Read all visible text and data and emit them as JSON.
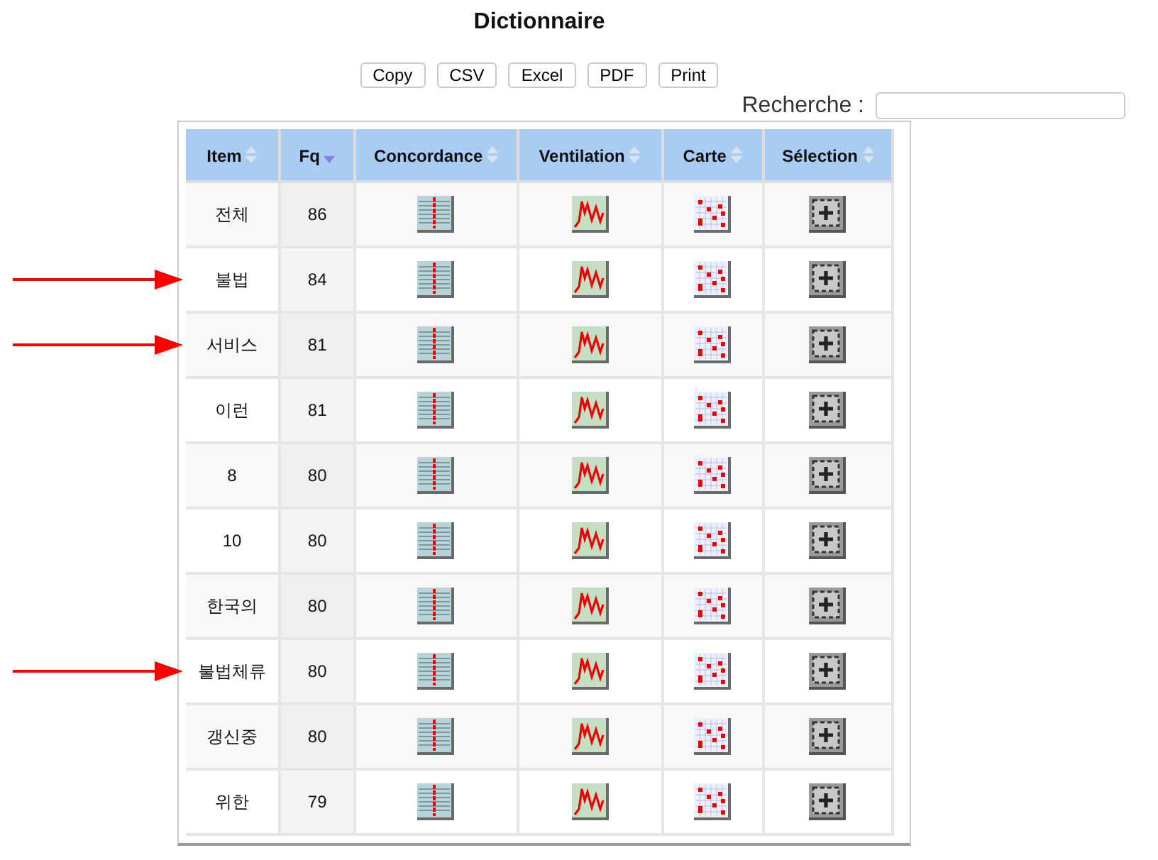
{
  "title": "Dictionnaire",
  "buttons": [
    "Copy",
    "CSV",
    "Excel",
    "PDF",
    "Print"
  ],
  "search": {
    "label": "Recherche :"
  },
  "table": {
    "columns": [
      {
        "label": "Item",
        "kind": "item",
        "sorted": false
      },
      {
        "label": "Fq",
        "kind": "count",
        "sorted": true
      },
      {
        "label": "Concordance",
        "kind": "concordance",
        "sorted": false
      },
      {
        "label": "Ventilation",
        "kind": "ventilation",
        "sorted": false
      },
      {
        "label": "Carte",
        "kind": "map",
        "sorted": false
      },
      {
        "label": "Sélection",
        "kind": "selection",
        "sorted": false
      }
    ],
    "rows": [
      {
        "item": "전체",
        "fq": "86",
        "marked": false
      },
      {
        "item": "불법",
        "fq": "84",
        "marked": true
      },
      {
        "item": "서비스",
        "fq": "81",
        "marked": true
      },
      {
        "item": "이런",
        "fq": "81",
        "marked": false
      },
      {
        "item": "8",
        "fq": "80",
        "marked": false
      },
      {
        "item": "10",
        "fq": "80",
        "marked": false
      },
      {
        "item": "한국의",
        "fq": "80",
        "marked": false
      },
      {
        "item": "불법체류",
        "fq": "80",
        "marked": true
      },
      {
        "item": "갱신중",
        "fq": "80",
        "marked": false
      },
      {
        "item": "위한",
        "fq": "79",
        "marked": false
      }
    ]
  }
}
